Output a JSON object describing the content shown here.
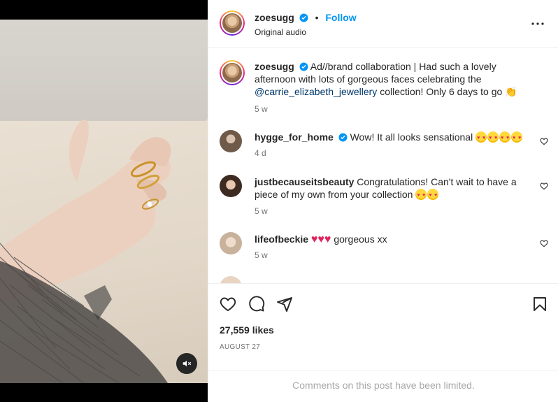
{
  "post": {
    "author": "zoesugg",
    "follow_label": "Follow",
    "dot": "•",
    "audio": "Original audio",
    "caption_prefix": "Ad//brand collaboration | Had such a lovely afternoon with lots of gorgeous faces celebrating the",
    "caption_mention": "@carrie_elizabeth_jewellery",
    "caption_suffix": "collection! Only 6 days to go",
    "caption_time": "5 w",
    "likes": "27,559 likes",
    "date": "AUGUST 27",
    "comments_limited": "Comments on this post have been limited."
  },
  "comments": [
    {
      "user": "hygge_for_home",
      "text": "Wow! It all looks sensational",
      "time": "4 d"
    },
    {
      "user": "justbecauseitsbeauty",
      "text": "Congratulations! Can't wait to have a piece of my own from your collection",
      "time": "5 w"
    },
    {
      "user": "lifeofbeckie",
      "text": "gorgeous xx",
      "time": "5 w"
    },
    {
      "user": "...",
      "text": "",
      "time": ""
    }
  ],
  "icons": {
    "more": "more-options-icon",
    "like": "heart-icon",
    "comment": "comment-icon",
    "share": "send-icon",
    "save": "bookmark-icon",
    "mute": "muted-speaker-icon",
    "verified": "verified-badge-icon"
  },
  "colors": {
    "accent": "#0095f6",
    "mention": "#00376b",
    "muted_text": "#737373",
    "limited_text": "#a8a8a8"
  }
}
